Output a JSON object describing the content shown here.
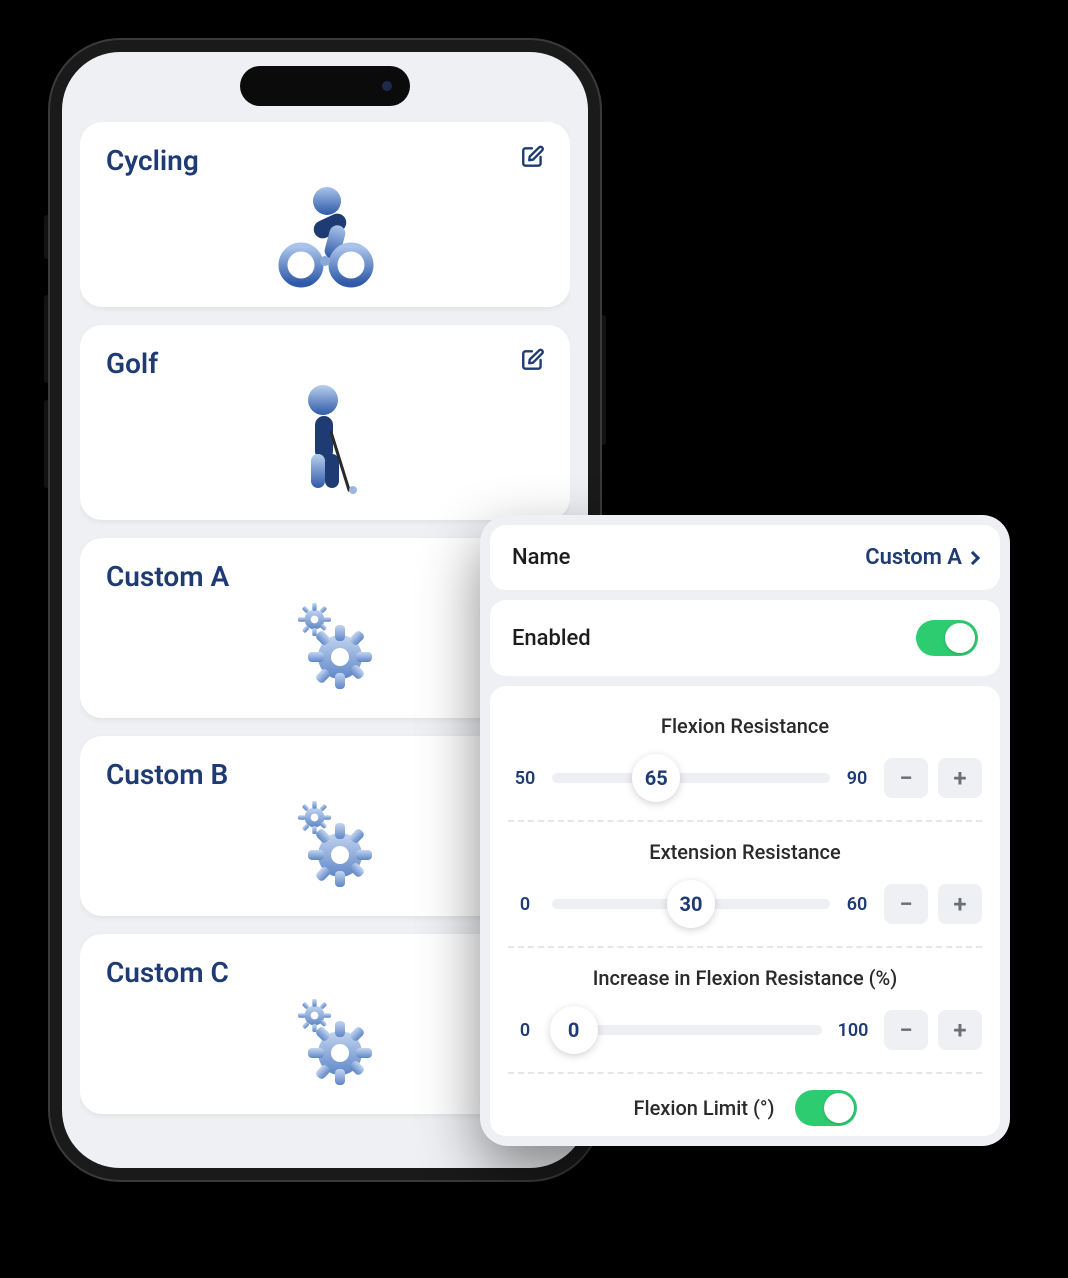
{
  "activities": [
    {
      "title": "Cycling",
      "icon": "cycling-icon",
      "editable": true
    },
    {
      "title": "Golf",
      "icon": "golf-icon",
      "editable": true
    },
    {
      "title": "Custom A",
      "icon": "gears-icon",
      "editable": false
    },
    {
      "title": "Custom B",
      "icon": "gears-icon",
      "editable": false
    },
    {
      "title": "Custom C",
      "icon": "gears-icon",
      "editable": false
    }
  ],
  "settings": {
    "name_label": "Name",
    "name_value": "Custom A",
    "enabled_label": "Enabled",
    "enabled": true,
    "sliders": [
      {
        "title": "Flexion Resistance",
        "min": 50,
        "max": 90,
        "value": 65
      },
      {
        "title": "Extension Resistance",
        "min": 0,
        "max": 60,
        "value": 30
      },
      {
        "title": "Increase in Flexion Resistance (%)",
        "min": 0,
        "max": 100,
        "value": 0
      }
    ],
    "flexion_limit": {
      "title": "Flexion Limit (°)",
      "enabled": true
    }
  },
  "colors": {
    "primary": "#1f3b73",
    "panel_bg": "#eef0f3",
    "toggle_on": "#2ecc71"
  }
}
